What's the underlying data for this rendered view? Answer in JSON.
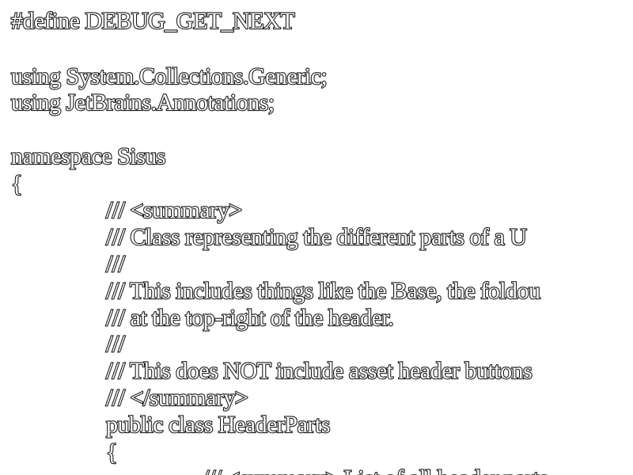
{
  "document": {
    "lines": [
      {
        "text": "#define DEBUG_GET_NEXT"
      },
      {
        "text": ""
      },
      {
        "text": "using System.Collections.Generic;"
      },
      {
        "text": "using JetBrains.Annotations;"
      },
      {
        "text": ""
      },
      {
        "text": "namespace Sisus"
      },
      {
        "text": "{"
      },
      {
        "text": "/// <summary>"
      },
      {
        "text": "/// Class representing the different parts of a U"
      },
      {
        "text": "///"
      },
      {
        "text": "/// This includes things like the Base, the foldou"
      },
      {
        "text": "/// at the top-right of the header."
      },
      {
        "text": "///"
      },
      {
        "text": "/// This does NOT include asset header buttons"
      },
      {
        "text": "/// </summary>"
      },
      {
        "text": "public class HeaderParts"
      },
      {
        "text": "{"
      },
      {
        "text": "/// <summary> List of all header parts"
      }
    ]
  },
  "colors": {
    "background": "#ffffff",
    "text_fill": "#ffffff",
    "text_outline": "#1a1a1a"
  }
}
